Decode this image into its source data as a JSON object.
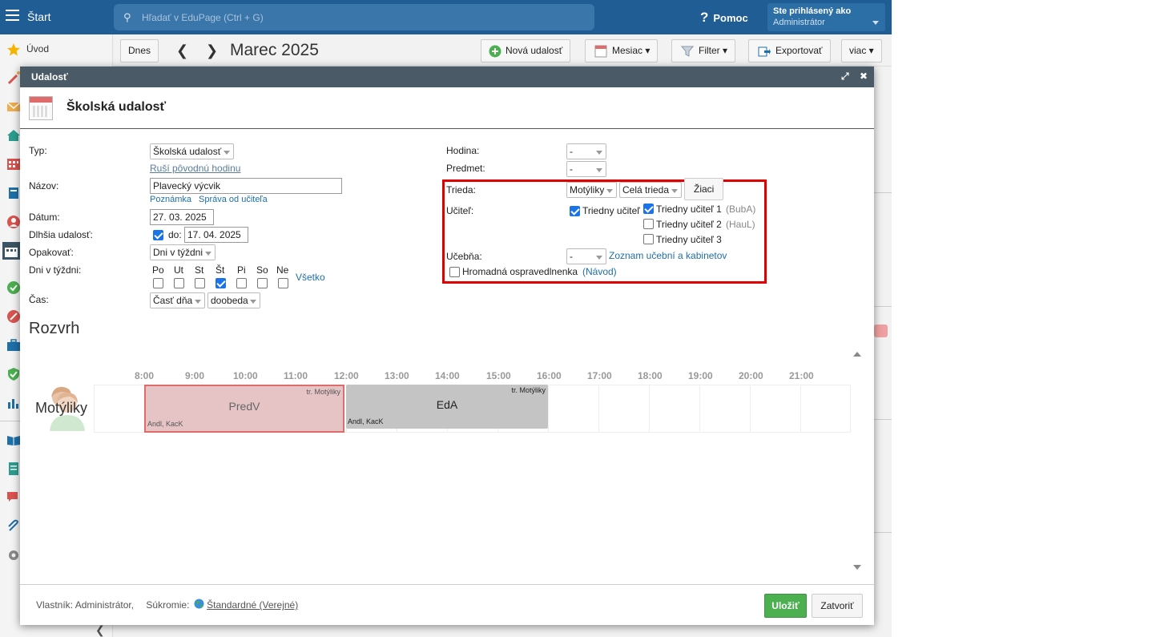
{
  "topbar": {
    "start": "Štart",
    "search_placeholder": "Hľadať v EduPage (Ctrl + G)",
    "help": "Pomoc",
    "help_mark": "?",
    "user_line1": "Ste prihlásený ako",
    "user_line2": "Administrátor"
  },
  "sidebar": {
    "uvod": "Úvod"
  },
  "toolbar": {
    "today": "Dnes",
    "month": "Marec 2025",
    "new_event": "Nová udalosť",
    "month_view": "Mesiac ▾",
    "filter": "Filter ▾",
    "export": "Exportovať",
    "more": "viac ▾",
    "prev": "❮",
    "next": "❯"
  },
  "dialog": {
    "title": "Udalosť",
    "event_type_title": "Školská udalosť",
    "expand": "⤢",
    "close": "✖"
  },
  "form": {
    "typ_label": "Typ:",
    "typ_value": "Školská udalosť",
    "cancels_lesson": "Ruší pôvodnú hodinu",
    "nazov_label": "Názov:",
    "nazov_value": "Plavecký výcvik",
    "poznamka": "Poznámka",
    "sprava": "Správa od učiteľa",
    "datum_label": "Dátum:",
    "datum_value": "27. 03. 2025",
    "dlhsia_label": "Dlhšia udalosť:",
    "do_label": "do:",
    "do_value": "17. 04. 2025",
    "opakovat_label": "Opakovať:",
    "opakovat_value": "Dni v týždni",
    "dni_label": "Dni v týždni:",
    "days": [
      "Po",
      "Ut",
      "St",
      "Št",
      "Pi",
      "So",
      "Ne"
    ],
    "vsetko": "Všetko",
    "cas_label": "Čas:",
    "cas_value": "Časť dňa",
    "cas_part": "doobeda",
    "hodina_label": "Hodina:",
    "hodina_value": "-",
    "predmet_label": "Predmet:",
    "predmet_value": "-",
    "trieda_label": "Trieda:",
    "trieda_value": "Motýliky",
    "trieda_scope": "Celá trieda",
    "ziaci": "Žiaci",
    "ucitel_label": "Učiteľ:",
    "triedny_ucitel": "Triedny učiteľ",
    "triedny_ucitel_1": "Triedny učiteľ 1",
    "triedny_ucitel_1_code": "(BubA)",
    "triedny_ucitel_2": "Triedny učiteľ 2",
    "triedny_ucitel_2_code": "(HauL)",
    "triedny_ucitel_3": "Triedny učiteľ 3",
    "ucebna_label": "Učebňa:",
    "ucebna_value": "-",
    "zoznam": "Zoznam učební a kabinetov",
    "hromadna": "Hromadná ospravedlnenka",
    "navod": "(Návod)"
  },
  "schedule": {
    "title": "Rozvrh",
    "row_label": "Motýliky",
    "hours": [
      "8:00",
      "9:00",
      "10:00",
      "11:00",
      "12:00",
      "13:00",
      "14:00",
      "15:00",
      "16:00",
      "17:00",
      "18:00",
      "19:00",
      "20:00",
      "21:00"
    ],
    "events": [
      {
        "name": "PredV",
        "tag": "tr. Motýliky",
        "teachers": "Andl, KacK"
      },
      {
        "name": "EdA",
        "tag": "tr. Motýliky",
        "teachers": "Andl, KacK"
      }
    ]
  },
  "footer": {
    "owner": "Vlastník: Administrátor,",
    "privacy_label": "Súkromie:",
    "privacy_value": "Štandardné (Verejné)",
    "save": "Uložiť",
    "close": "Zatvoriť"
  },
  "colors": {
    "topbar": "#1f5d94",
    "highlight": "#e00000",
    "save_green": "#4caf50",
    "event_pink": "#e6c4c6",
    "event_gray": "#c4c4c4"
  }
}
